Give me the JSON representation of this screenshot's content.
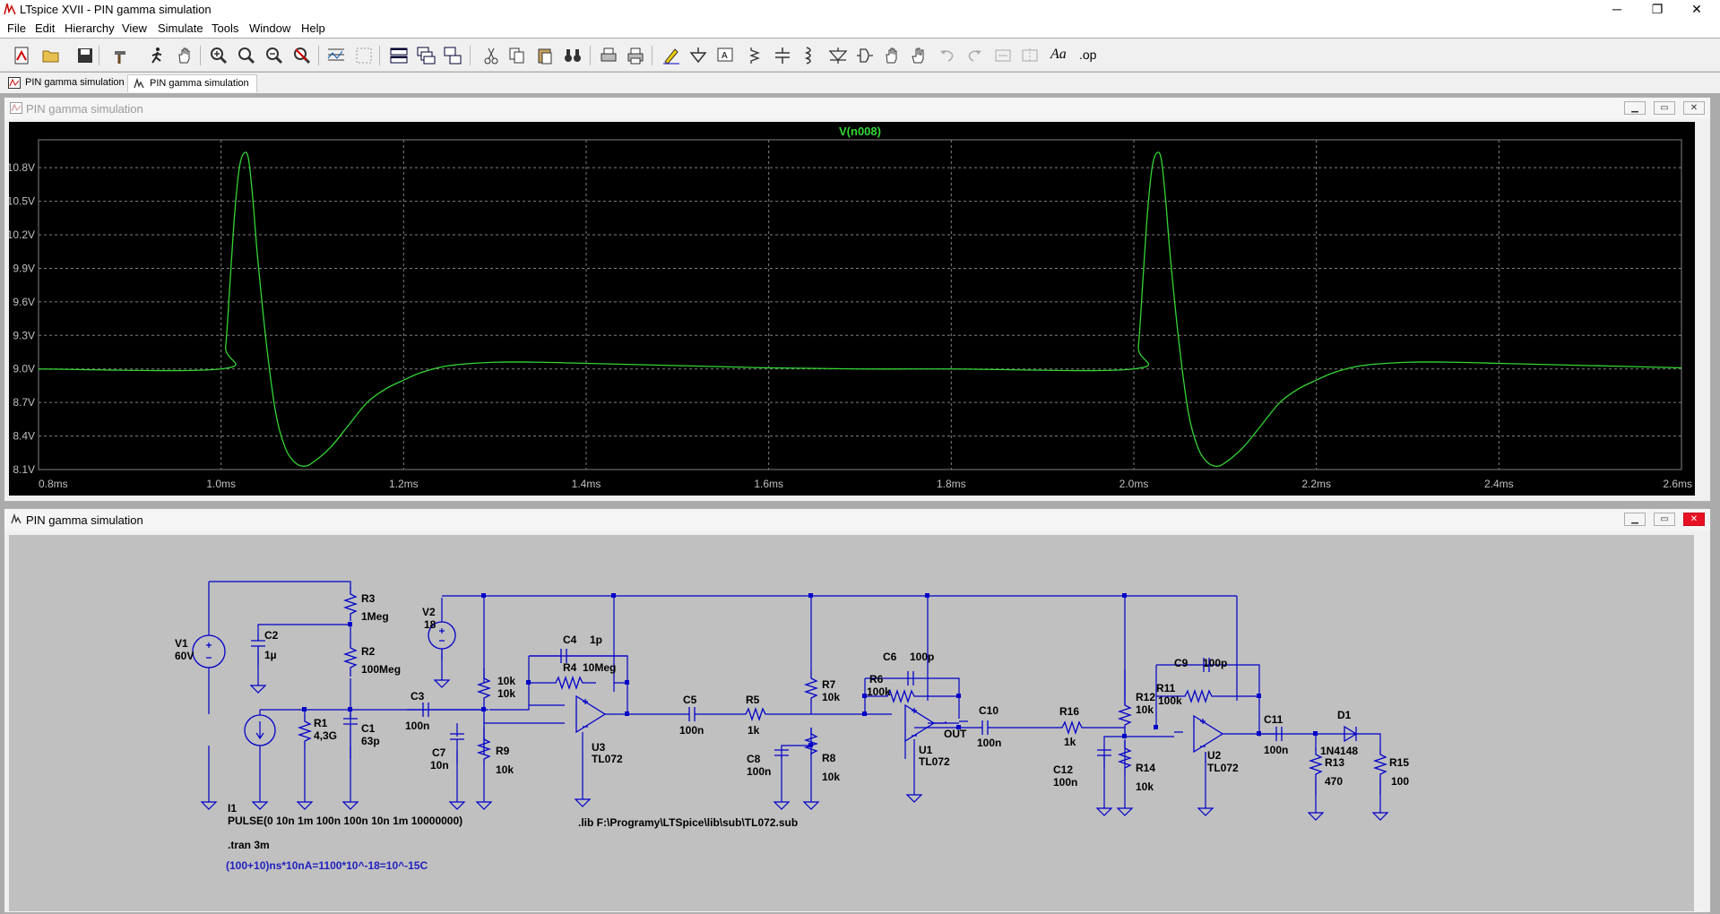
{
  "app": {
    "title": "LTspice XVII - PIN gamma simulation"
  },
  "window_controls": {
    "minimize": "─",
    "maximize": "❐",
    "close": "✕"
  },
  "menu": {
    "items": [
      {
        "label": "File",
        "key": "F"
      },
      {
        "label": "Edit",
        "key": "E"
      },
      {
        "label": "Hierarchy",
        "key": "H"
      },
      {
        "label": "View",
        "key": "V"
      },
      {
        "label": "Simulate",
        "key": "S"
      },
      {
        "label": "Tools",
        "key": "T"
      },
      {
        "label": "Window",
        "key": "W"
      },
      {
        "label": "Help",
        "key": "H"
      }
    ]
  },
  "toolbar": {
    "op_label": ".op",
    "font_label": "Aa"
  },
  "tabs": [
    {
      "label": "PIN gamma simulation",
      "icon": "waveform-icon"
    },
    {
      "label": "PIN gamma simulation",
      "icon": "schematic-icon",
      "active": true
    }
  ],
  "plot_window": {
    "title": "PIN gamma simulation",
    "trace_label": "V(n008)",
    "trace_color": "#33d633"
  },
  "schematic_window": {
    "title": "PIN gamma simulation"
  },
  "chart_data": {
    "type": "line",
    "title": "V(n008)",
    "xlabel": "",
    "ylabel": "",
    "xlim": [
      0.8,
      2.6
    ],
    "ylim": [
      8.1,
      11.05
    ],
    "x_ticks": [
      "0.8ms",
      "1.0ms",
      "1.2ms",
      "1.4ms",
      "1.6ms",
      "1.8ms",
      "2.0ms",
      "2.2ms",
      "2.4ms",
      "2.6ms"
    ],
    "y_ticks": [
      "10.8V",
      "10.5V",
      "10.2V",
      "9.9V",
      "9.6V",
      "9.3V",
      "9.0V",
      "8.7V",
      "8.4V",
      "8.1V"
    ],
    "grid": true,
    "series": [
      {
        "name": "V(n008)",
        "color": "#33d633",
        "x": [
          0.8,
          1.0,
          1.005,
          1.01,
          1.015,
          1.02,
          1.025,
          1.03,
          1.035,
          1.04,
          1.05,
          1.06,
          1.07,
          1.08,
          1.09,
          1.1,
          1.12,
          1.14,
          1.16,
          1.18,
          1.2,
          1.22,
          1.25,
          1.3,
          1.35,
          1.4,
          1.5,
          1.6,
          1.7,
          1.8,
          2.0,
          2.005,
          2.01,
          2.015,
          2.02,
          2.025,
          2.03,
          2.035,
          2.04,
          2.05,
          2.06,
          2.07,
          2.08,
          2.09,
          2.1,
          2.12,
          2.14,
          2.16,
          2.18,
          2.2,
          2.22,
          2.25,
          2.3,
          2.35,
          2.4,
          2.5,
          2.6
        ],
        "y": [
          9.0,
          9.0,
          9.2,
          9.8,
          10.4,
          10.8,
          10.93,
          10.88,
          10.5,
          10.0,
          9.2,
          8.6,
          8.3,
          8.17,
          8.13,
          8.16,
          8.3,
          8.5,
          8.7,
          8.82,
          8.9,
          8.97,
          9.03,
          9.06,
          9.06,
          9.05,
          9.03,
          9.01,
          9.0,
          9.0,
          9.0,
          9.2,
          9.8,
          10.4,
          10.8,
          10.93,
          10.88,
          10.5,
          10.0,
          9.2,
          8.6,
          8.3,
          8.17,
          8.13,
          8.16,
          8.3,
          8.5,
          8.7,
          8.82,
          8.9,
          8.97,
          9.03,
          9.06,
          9.06,
          9.05,
          9.03,
          9.01
        ]
      }
    ]
  },
  "schematic": {
    "labels": {
      "v1_name": "V1",
      "v1_val": "60V",
      "v2_name": "V2",
      "v2_val": "18",
      "r3_name": "R3",
      "r3_val": "1Meg",
      "c2_name": "C2",
      "c2_val": "1µ",
      "r2_name": "R2",
      "r2_val": "100Meg",
      "r1_name": "R1",
      "r1_val": "4,3G",
      "c1_name": "C1",
      "c1_val": "63p",
      "c3_name": "C3",
      "c3_val": "100n",
      "pot1_a": "10k",
      "pot1_b": "10k",
      "c7_name": "C7",
      "c7_val": "10n",
      "r9_name": "R9",
      "r9_val": "10k",
      "c4_name": "C4",
      "c4_val": "1p",
      "r4_name": "R4",
      "r4_val": "10Meg",
      "u3_name": "U3",
      "u3_val": "TL072",
      "c5_name": "C5",
      "c5_val": "100n",
      "r5_name": "R5",
      "r5_val": "1k",
      "r7_name": "R7",
      "r7_val": "10k",
      "c8_name": "C8",
      "c8_val": "100n",
      "r8_name": "R8",
      "r8_val": "10k",
      "c6_name": "C6",
      "c6_val": "100p",
      "r6_name": "R6",
      "r6_val": "100k",
      "u1_name": "U1",
      "u1_val": "TL072",
      "out_label": "OUT",
      "c10_name": "C10",
      "c10_val": "100n",
      "r16_name": "R16",
      "r16_val": "1k",
      "r12_name": "R12",
      "r12_val": "10k",
      "c12_name": "C12",
      "c12_val": "100n",
      "r14_name": "R14",
      "r14_val": "10k",
      "c9_name": "C9",
      "c9_val": "100p",
      "r11_name": "R11",
      "r11_val": "100k",
      "u2_name": "U2",
      "u2_val": "TL072",
      "c11_name": "C11",
      "c11_val": "100n",
      "d1_name": "D1",
      "d1_val": "1N4148",
      "r13_name": "R13",
      "r13_val": "470",
      "r15_name": "R15",
      "r15_val": "100",
      "i1_name": "I1",
      "i1_val": "PULSE(0 10n 1m 100n 100n 10n 1m 10000000)",
      "lib_directive": ".lib F:\\Programy\\LTSpice\\lib\\sub\\TL072.sub",
      "tran_directive": ".tran 3m",
      "comment": "(100+10)ns*10nA=1100*10^-18=10^-15C"
    }
  }
}
